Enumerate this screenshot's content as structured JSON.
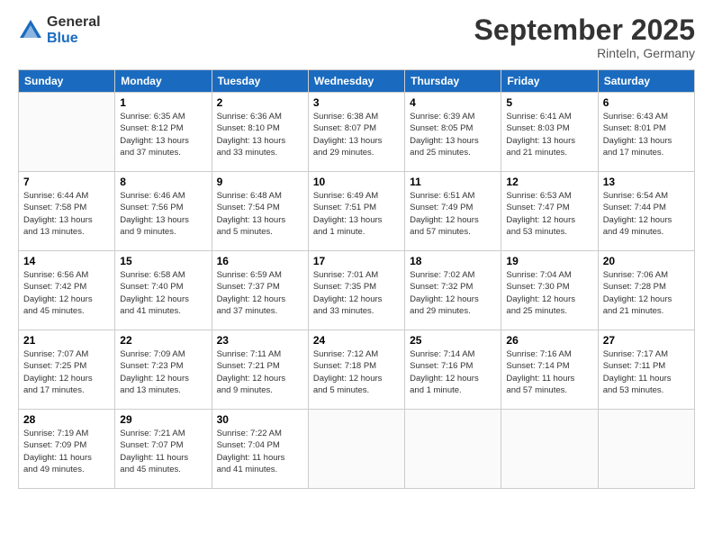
{
  "logo": {
    "general": "General",
    "blue": "Blue"
  },
  "title": "September 2025",
  "location": "Rinteln, Germany",
  "days": [
    "Sunday",
    "Monday",
    "Tuesday",
    "Wednesday",
    "Thursday",
    "Friday",
    "Saturday"
  ],
  "weeks": [
    [
      {
        "day": "",
        "content": ""
      },
      {
        "day": "1",
        "content": "Sunrise: 6:35 AM\nSunset: 8:12 PM\nDaylight: 13 hours\nand 37 minutes."
      },
      {
        "day": "2",
        "content": "Sunrise: 6:36 AM\nSunset: 8:10 PM\nDaylight: 13 hours\nand 33 minutes."
      },
      {
        "day": "3",
        "content": "Sunrise: 6:38 AM\nSunset: 8:07 PM\nDaylight: 13 hours\nand 29 minutes."
      },
      {
        "day": "4",
        "content": "Sunrise: 6:39 AM\nSunset: 8:05 PM\nDaylight: 13 hours\nand 25 minutes."
      },
      {
        "day": "5",
        "content": "Sunrise: 6:41 AM\nSunset: 8:03 PM\nDaylight: 13 hours\nand 21 minutes."
      },
      {
        "day": "6",
        "content": "Sunrise: 6:43 AM\nSunset: 8:01 PM\nDaylight: 13 hours\nand 17 minutes."
      }
    ],
    [
      {
        "day": "7",
        "content": "Sunrise: 6:44 AM\nSunset: 7:58 PM\nDaylight: 13 hours\nand 13 minutes."
      },
      {
        "day": "8",
        "content": "Sunrise: 6:46 AM\nSunset: 7:56 PM\nDaylight: 13 hours\nand 9 minutes."
      },
      {
        "day": "9",
        "content": "Sunrise: 6:48 AM\nSunset: 7:54 PM\nDaylight: 13 hours\nand 5 minutes."
      },
      {
        "day": "10",
        "content": "Sunrise: 6:49 AM\nSunset: 7:51 PM\nDaylight: 13 hours\nand 1 minute."
      },
      {
        "day": "11",
        "content": "Sunrise: 6:51 AM\nSunset: 7:49 PM\nDaylight: 12 hours\nand 57 minutes."
      },
      {
        "day": "12",
        "content": "Sunrise: 6:53 AM\nSunset: 7:47 PM\nDaylight: 12 hours\nand 53 minutes."
      },
      {
        "day": "13",
        "content": "Sunrise: 6:54 AM\nSunset: 7:44 PM\nDaylight: 12 hours\nand 49 minutes."
      }
    ],
    [
      {
        "day": "14",
        "content": "Sunrise: 6:56 AM\nSunset: 7:42 PM\nDaylight: 12 hours\nand 45 minutes."
      },
      {
        "day": "15",
        "content": "Sunrise: 6:58 AM\nSunset: 7:40 PM\nDaylight: 12 hours\nand 41 minutes."
      },
      {
        "day": "16",
        "content": "Sunrise: 6:59 AM\nSunset: 7:37 PM\nDaylight: 12 hours\nand 37 minutes."
      },
      {
        "day": "17",
        "content": "Sunrise: 7:01 AM\nSunset: 7:35 PM\nDaylight: 12 hours\nand 33 minutes."
      },
      {
        "day": "18",
        "content": "Sunrise: 7:02 AM\nSunset: 7:32 PM\nDaylight: 12 hours\nand 29 minutes."
      },
      {
        "day": "19",
        "content": "Sunrise: 7:04 AM\nSunset: 7:30 PM\nDaylight: 12 hours\nand 25 minutes."
      },
      {
        "day": "20",
        "content": "Sunrise: 7:06 AM\nSunset: 7:28 PM\nDaylight: 12 hours\nand 21 minutes."
      }
    ],
    [
      {
        "day": "21",
        "content": "Sunrise: 7:07 AM\nSunset: 7:25 PM\nDaylight: 12 hours\nand 17 minutes."
      },
      {
        "day": "22",
        "content": "Sunrise: 7:09 AM\nSunset: 7:23 PM\nDaylight: 12 hours\nand 13 minutes."
      },
      {
        "day": "23",
        "content": "Sunrise: 7:11 AM\nSunset: 7:21 PM\nDaylight: 12 hours\nand 9 minutes."
      },
      {
        "day": "24",
        "content": "Sunrise: 7:12 AM\nSunset: 7:18 PM\nDaylight: 12 hours\nand 5 minutes."
      },
      {
        "day": "25",
        "content": "Sunrise: 7:14 AM\nSunset: 7:16 PM\nDaylight: 12 hours\nand 1 minute."
      },
      {
        "day": "26",
        "content": "Sunrise: 7:16 AM\nSunset: 7:14 PM\nDaylight: 11 hours\nand 57 minutes."
      },
      {
        "day": "27",
        "content": "Sunrise: 7:17 AM\nSunset: 7:11 PM\nDaylight: 11 hours\nand 53 minutes."
      }
    ],
    [
      {
        "day": "28",
        "content": "Sunrise: 7:19 AM\nSunset: 7:09 PM\nDaylight: 11 hours\nand 49 minutes."
      },
      {
        "day": "29",
        "content": "Sunrise: 7:21 AM\nSunset: 7:07 PM\nDaylight: 11 hours\nand 45 minutes."
      },
      {
        "day": "30",
        "content": "Sunrise: 7:22 AM\nSunset: 7:04 PM\nDaylight: 11 hours\nand 41 minutes."
      },
      {
        "day": "",
        "content": ""
      },
      {
        "day": "",
        "content": ""
      },
      {
        "day": "",
        "content": ""
      },
      {
        "day": "",
        "content": ""
      }
    ]
  ]
}
